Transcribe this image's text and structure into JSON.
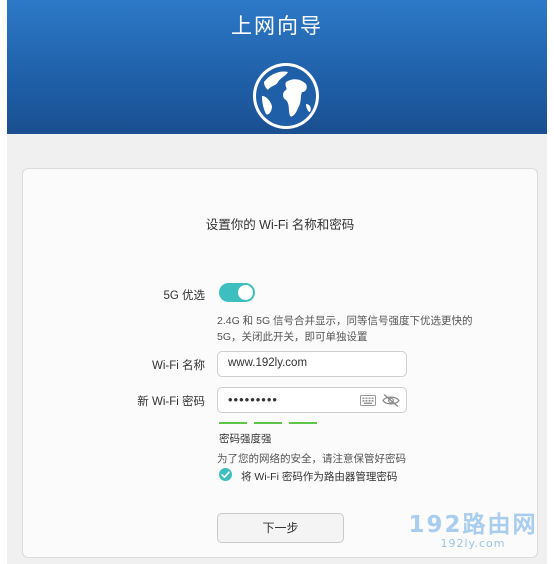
{
  "header": {
    "title": "上网向导"
  },
  "card": {
    "title": "设置你的 Wi-Fi 名称和密码",
    "prefer_5g": {
      "label": "5G 优选",
      "enabled": true,
      "hint_line1": "2.4G 和 5G 信号合并显示，同等信号强度下优选更快的",
      "hint_line2": "5G，关闭此开关，即可单独设置"
    },
    "wifi_name": {
      "label": "Wi-Fi 名称",
      "value": "www.192ly.com"
    },
    "wifi_password": {
      "label": "新 Wi-Fi 密码",
      "value": "•••••••••",
      "strength_text": "密码强度强"
    },
    "security_note": "为了您的网络的安全，请注意保管好密码",
    "use_as_admin": {
      "label": "将 Wi-Fi 密码作为路由器管理密码",
      "checked": true
    },
    "next_button": "下一步"
  },
  "watermark": {
    "main": "192路由网",
    "sub": "192ly.com"
  },
  "colors": {
    "header_blue": "#2d79c7",
    "accent_teal": "#3ebfbf",
    "strength_green": "#5ec44a"
  }
}
